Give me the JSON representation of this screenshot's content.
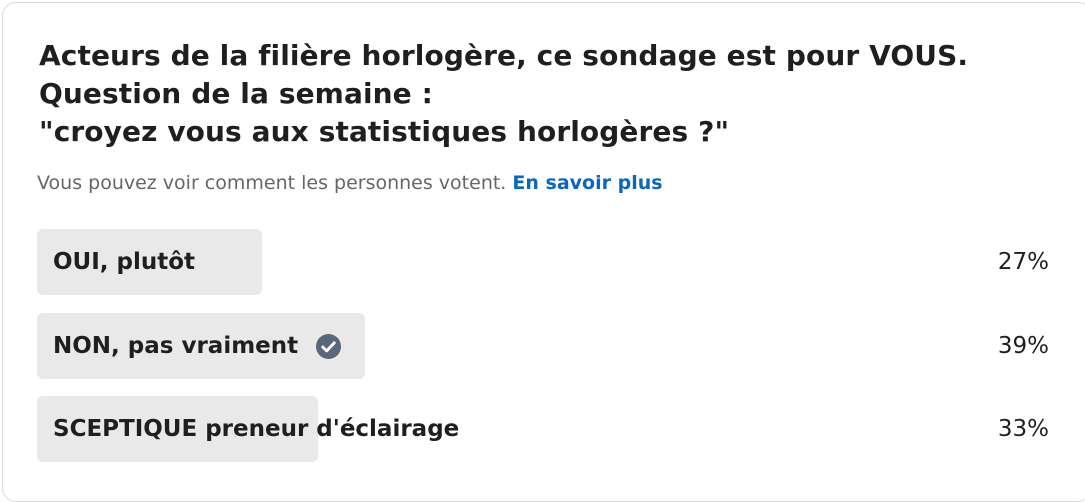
{
  "poll": {
    "question_lines": [
      "Acteurs de la filière horlogère, ce sondage est pour VOUS.",
      "Question de la semaine :",
      "\"croyez vous aux statistiques horlogères ?\""
    ],
    "visibility_note": "Vous pouvez voir comment les personnes votent.",
    "learn_more": "En savoir plus",
    "options": [
      {
        "label": "OUI, plutôt",
        "percent": "27%",
        "share": 0.27,
        "voted": false
      },
      {
        "label": "NON, pas vraiment",
        "percent": "39%",
        "share": 0.39,
        "voted": true
      },
      {
        "label": "SCEPTIQUE preneur d'éclairage",
        "percent": "33%",
        "share": 0.33,
        "voted": false
      }
    ],
    "voted_icon": "check-circle-icon",
    "colors": {
      "bar_fill": "#e9e9e9",
      "link": "#0a66c2",
      "check_badge": "#56687a",
      "text": "#1f1f1f",
      "muted": "#666666"
    }
  }
}
